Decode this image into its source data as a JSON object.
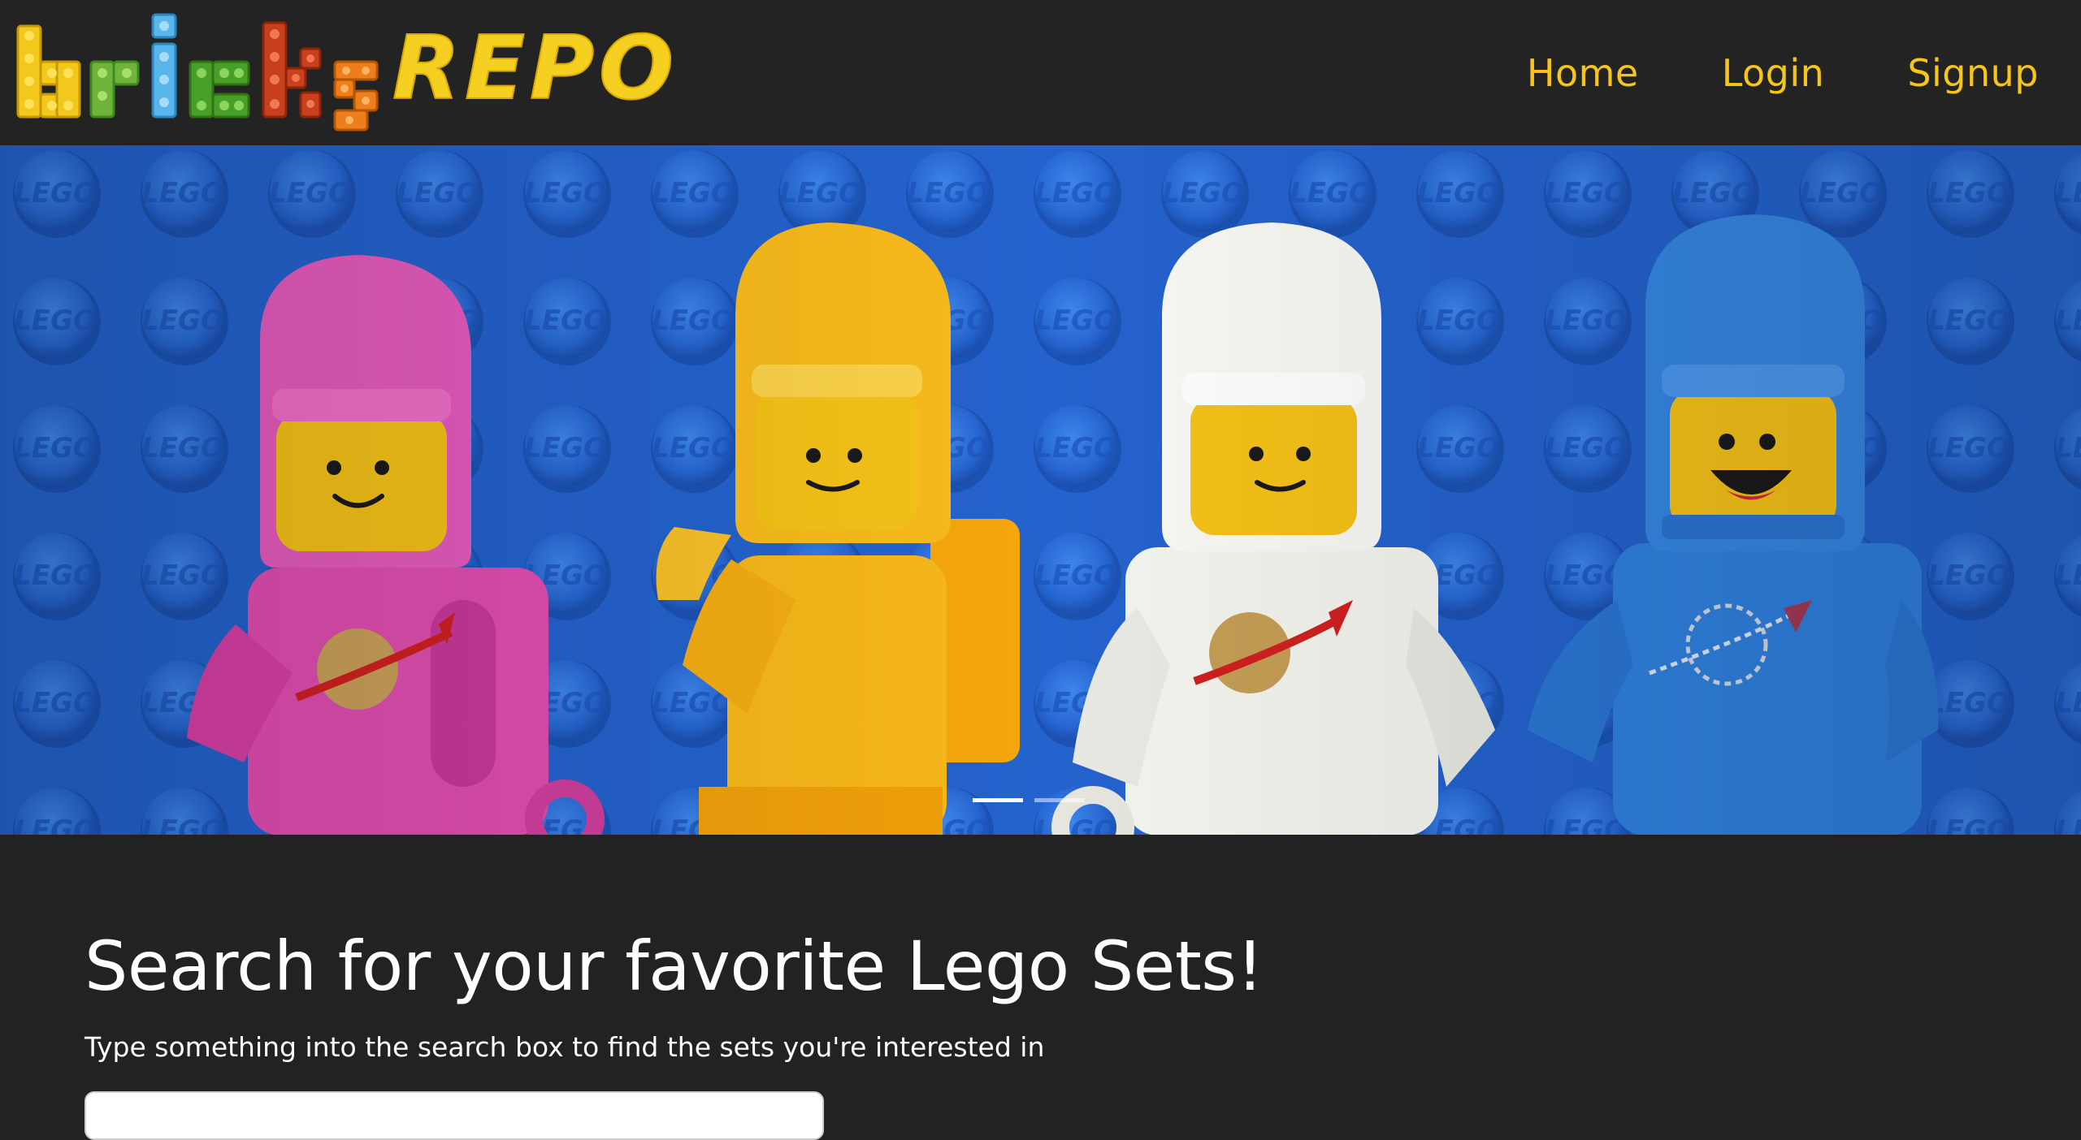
{
  "brand": {
    "logo_letters": "bricks",
    "logo_text": "REPO",
    "colors": {
      "yellow": "#f5d020",
      "green": "#5aa32a",
      "blue": "#4aa8e0",
      "darkgreen": "#3f8f22",
      "red": "#c43b1a",
      "orange": "#ec7a18"
    }
  },
  "nav": {
    "items": [
      {
        "label": "Home"
      },
      {
        "label": "Login"
      },
      {
        "label": "Signup"
      }
    ],
    "link_color": "#f5c518",
    "background": "#232323"
  },
  "hero": {
    "slides_count": 2,
    "active_slide": 1,
    "background_color": "#1f5fc9",
    "figures": [
      {
        "color": "pink",
        "hex": "#e24fb4"
      },
      {
        "color": "yellow",
        "hex": "#f5b820"
      },
      {
        "color": "white",
        "hex": "#f2f2ee"
      },
      {
        "color": "blue",
        "hex": "#2f7ee0"
      }
    ]
  },
  "search": {
    "title": "Search for your favorite Lego Sets!",
    "subtitle": "Type something into the search box to find the sets you're interested in",
    "placeholder": ""
  }
}
